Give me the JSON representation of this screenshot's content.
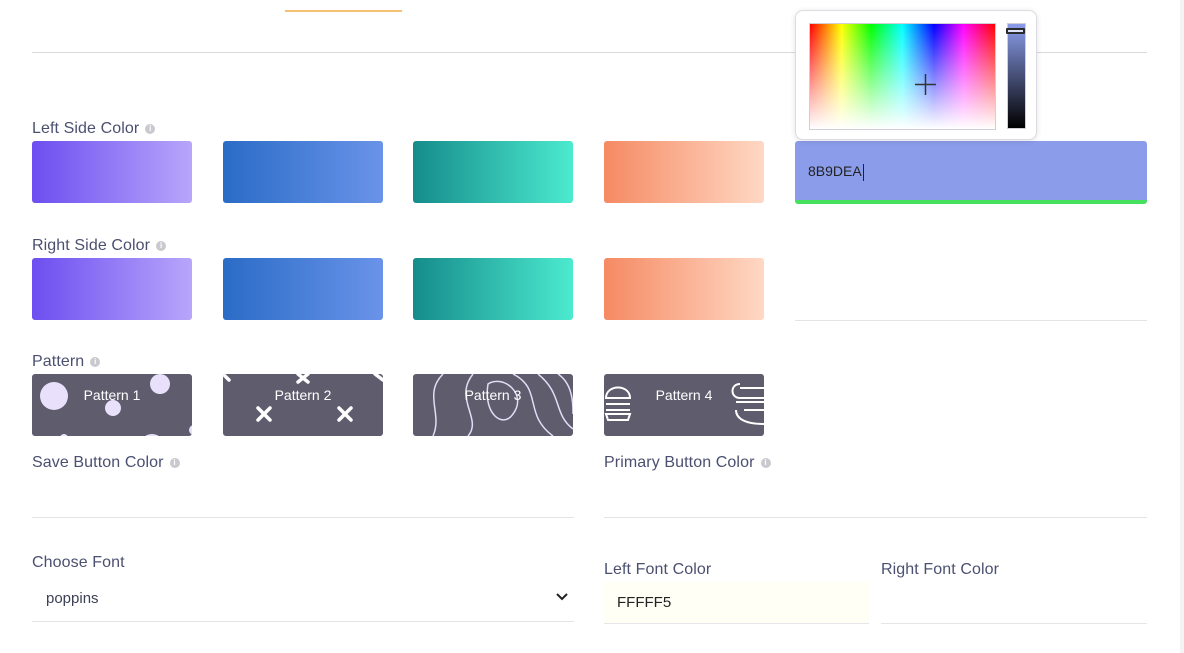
{
  "left_side_color": {
    "label": "Left Side Color",
    "swatches": [
      "purple-gradient",
      "blue-gradient",
      "teal-gradient",
      "peach-gradient"
    ],
    "hex_value": "8B9DEA",
    "selected_color": "#8b9dea"
  },
  "right_side_color": {
    "label": "Right Side Color",
    "swatches": [
      "purple-gradient",
      "blue-gradient",
      "teal-gradient",
      "peach-gradient"
    ]
  },
  "pattern": {
    "label": "Pattern",
    "items": [
      "Pattern 1",
      "Pattern 2",
      "Pattern 3",
      "Pattern 4"
    ]
  },
  "save_button_color": {
    "label": "Save Button Color"
  },
  "primary_button_color": {
    "label": "Primary Button Color"
  },
  "choose_font": {
    "label": "Choose Font",
    "value": "poppins"
  },
  "left_font_color": {
    "label": "Left Font Color",
    "value": "FFFFF5"
  },
  "right_font_color": {
    "label": "Right Font Color",
    "value": ""
  },
  "colors": {
    "accent_tab": "#f5c173",
    "active_field_underline": "#46e05f",
    "pattern_tile": "#5e5c6d"
  }
}
